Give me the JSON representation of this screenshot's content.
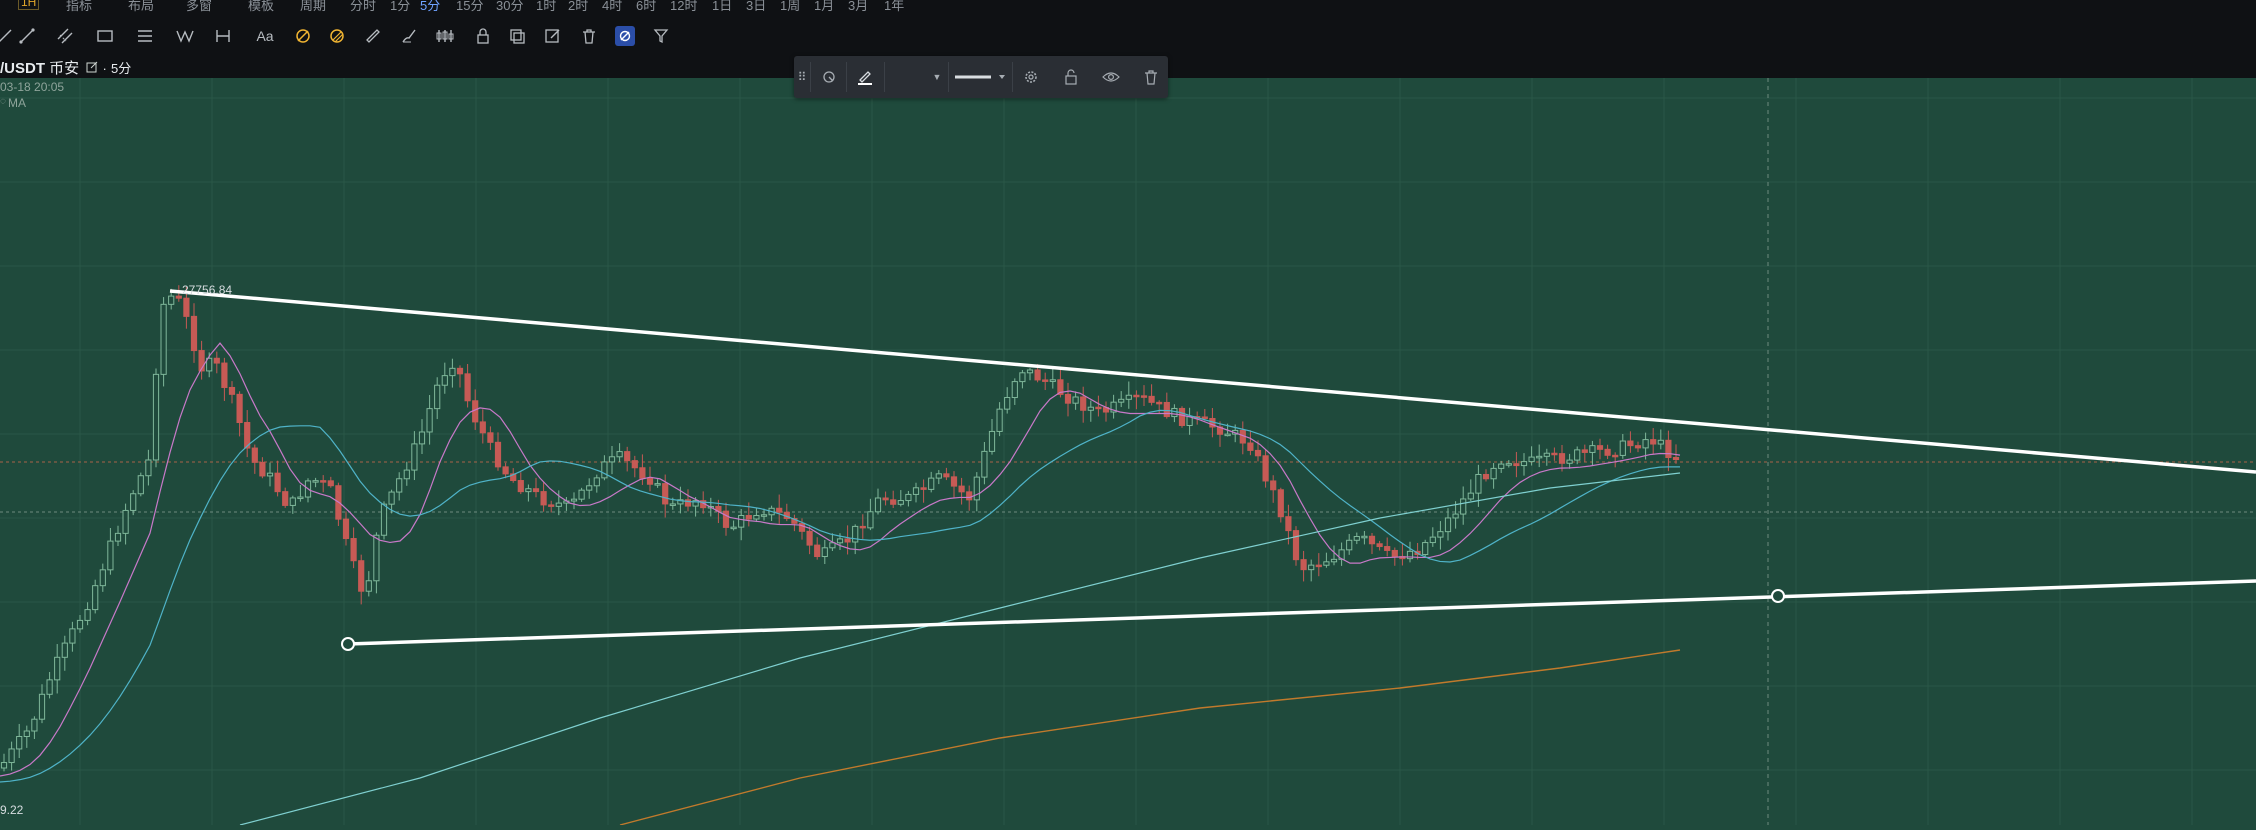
{
  "topbar": {
    "items": [
      "1H",
      "指标",
      "布局",
      "多窗",
      "模板",
      "周期",
      "分时",
      "1分",
      "5分",
      "15分",
      "30分",
      "1时",
      "2时",
      "4时",
      "6时",
      "12时",
      "1日",
      "3日",
      "1周",
      "1月",
      "3月",
      "1年"
    ],
    "active_interval": "5分"
  },
  "symbol": {
    "name": "/USDT",
    "exchange": "币安",
    "interval": "5分"
  },
  "legend": {
    "datetime": "03-18 20:05",
    "indicator": "MA"
  },
  "chart": {
    "high_label": "27756.84",
    "low_label": "9.22",
    "colors": {
      "background": "#1f4a3c",
      "up_candle": "#3f7a5f",
      "down_candle": "#c65a55",
      "ma_short": "#c879c9",
      "ma_mid": "#4fb3c8",
      "ma_long": "#7fd0d0",
      "ma_longest": "#c17a2c",
      "trendline": "#ffffff"
    }
  },
  "toolbar": {
    "icons": [
      "cross-icon",
      "line-icon",
      "parallel-channel-icon",
      "rectangle-icon",
      "fib-icon",
      "pattern-icon",
      "measure-icon",
      "text-icon",
      "magnet-icon",
      "lock-magnet-icon",
      "ruler-icon",
      "brush-icon",
      "bar-chart-icon",
      "lock-icon",
      "clone-icon",
      "edit-icon",
      "trash-icon",
      "visibility-icon",
      "filter-icon"
    ]
  }
}
